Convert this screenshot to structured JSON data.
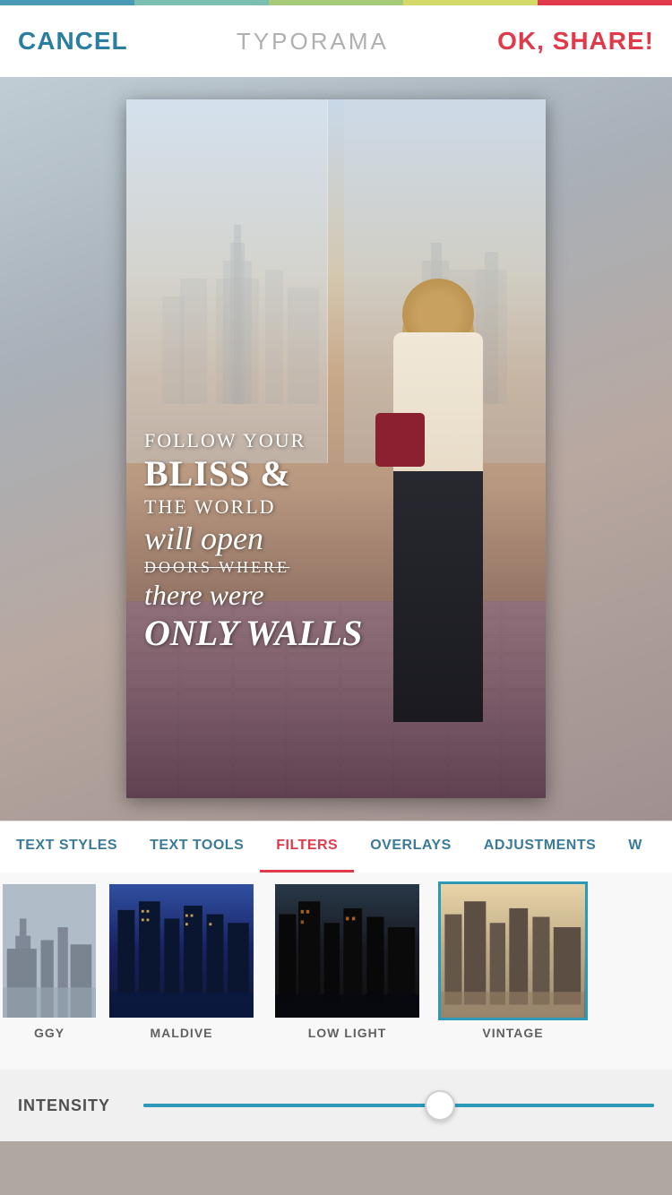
{
  "topBar": {
    "colors": [
      "#4a9ab5",
      "#7abfb0",
      "#a8c87a",
      "#d4da6a",
      "#e03a4a"
    ]
  },
  "header": {
    "cancel_label": "CANCEL",
    "title_label": "TYPORAMA",
    "ok_label": "OK, SHARE!"
  },
  "photo": {
    "text_lines": [
      {
        "id": "line1",
        "text": "FOLLOW YOUR"
      },
      {
        "id": "line2",
        "text": "BLISS &"
      },
      {
        "id": "line3",
        "text": "THE WORLD"
      },
      {
        "id": "line4",
        "text": "will open"
      },
      {
        "id": "line5",
        "text": "DOORS WHERE"
      },
      {
        "id": "line6",
        "text": "there were"
      },
      {
        "id": "line7",
        "text": "ONLY WALLS"
      }
    ]
  },
  "tabs": [
    {
      "id": "text-styles",
      "label": "TEXT STYLES",
      "active": false
    },
    {
      "id": "text-tools",
      "label": "TEXT TOOLS",
      "active": false
    },
    {
      "id": "filters",
      "label": "FILTERS",
      "active": true
    },
    {
      "id": "overlays",
      "label": "OVERLAYS",
      "active": false
    },
    {
      "id": "adjustments",
      "label": "ADJUSTMENTS",
      "active": false
    },
    {
      "id": "w",
      "label": "W",
      "active": false
    }
  ],
  "filters": [
    {
      "id": "foggy",
      "label": "GGY",
      "style": "foggy",
      "selected": false
    },
    {
      "id": "maldive",
      "label": "MALDIVE",
      "style": "maldive",
      "selected": false
    },
    {
      "id": "lowlight",
      "label": "LOW LIGHT",
      "style": "lowlight",
      "selected": false
    },
    {
      "id": "vintage",
      "label": "VINTAGE",
      "style": "vintage",
      "selected": true
    }
  ],
  "intensity": {
    "label": "INTENSITY",
    "value": 58
  }
}
